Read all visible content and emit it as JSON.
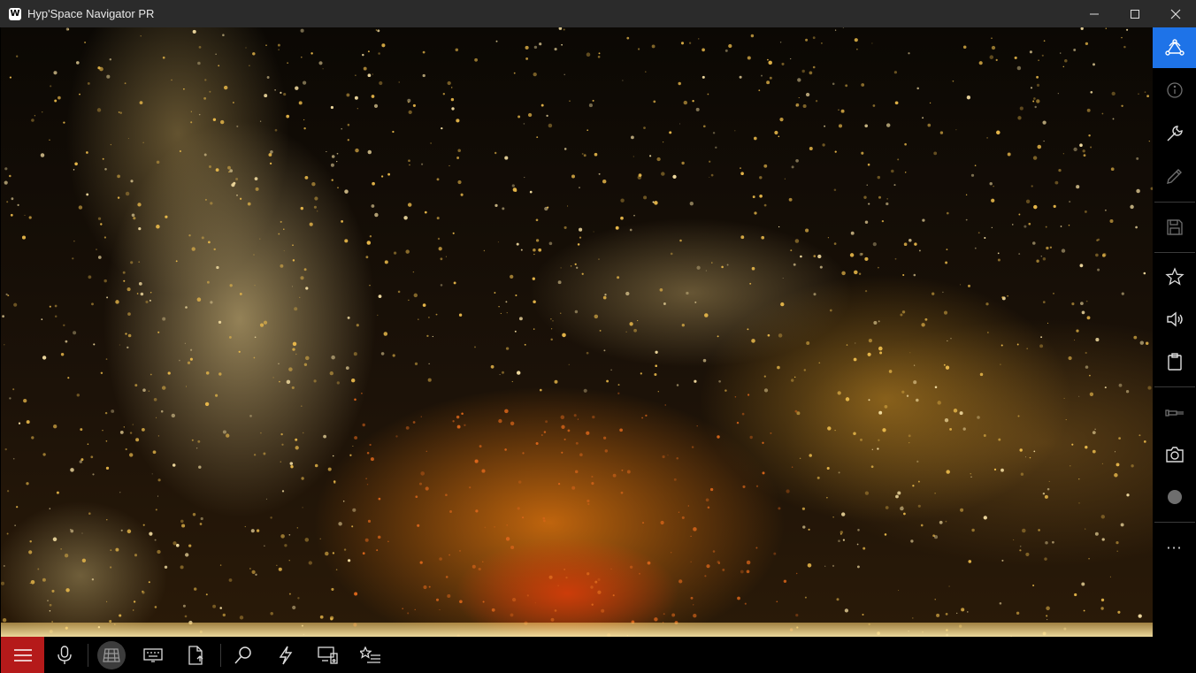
{
  "window": {
    "title": "Hyp'Space Navigator PR",
    "logo_letter": "W",
    "controls": [
      "minimize-icon",
      "maximize-icon",
      "close-icon"
    ]
  },
  "viewport": {
    "content": "sky-view",
    "accent_colors": [
      "#e8b84a",
      "#d9651a",
      "#f2dca0"
    ]
  },
  "right_toolbar": {
    "active_color": "#1e73e8",
    "items": [
      "sky-network-icon",
      "info-icon",
      "wrench-icon",
      "pencil-icon",
      "save-icon",
      "star-icon",
      "speaker-icon",
      "clipboard-icon",
      "telescope-icon",
      "camera-icon",
      "record-circle-icon",
      "more-icon"
    ],
    "more_label": "···"
  },
  "bottom_toolbar": {
    "menu_color": "#b51a1a",
    "items": [
      "hamburger-menu-icon",
      "microphone-icon",
      "grid-icon",
      "keyboard-icon",
      "export-file-icon",
      "search-icon",
      "lightning-icon",
      "devices-icon",
      "star-list-icon"
    ]
  }
}
